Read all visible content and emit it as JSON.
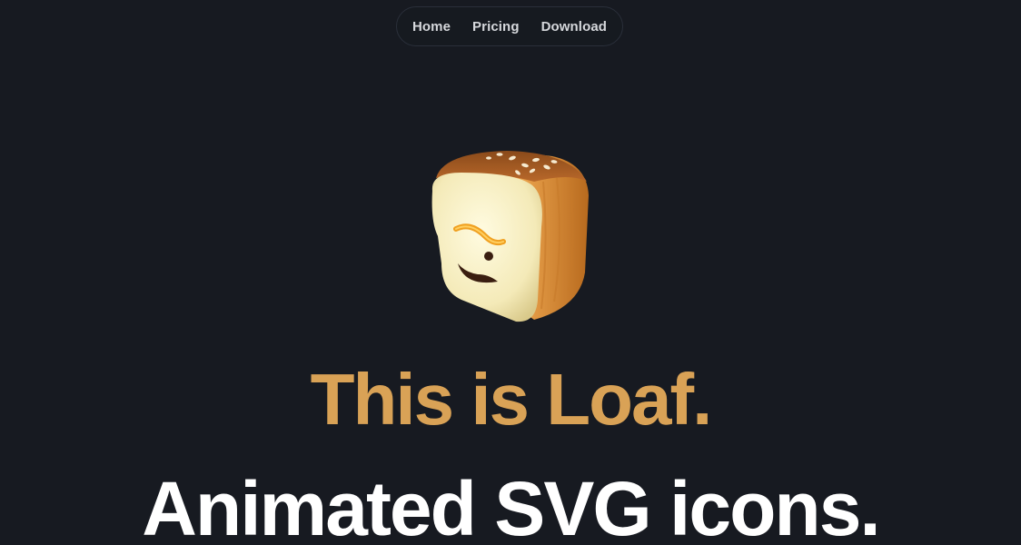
{
  "nav": {
    "items": [
      {
        "label": "Home"
      },
      {
        "label": "Pricing"
      },
      {
        "label": "Download"
      }
    ]
  },
  "hero": {
    "mascot_icon": "bread-loaf-mascot-icon",
    "title": "This is Loaf.",
    "subtitle": "Animated SVG icons."
  },
  "colors": {
    "background": "#171a21",
    "accent": "#d9a256",
    "text": "#ffffff",
    "nav_text": "#d6d8dc"
  }
}
